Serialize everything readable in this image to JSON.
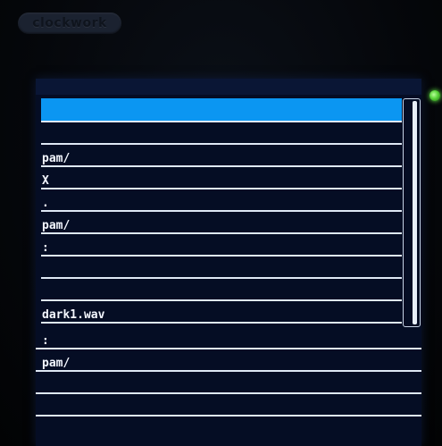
{
  "device": {
    "brand": "clockwork",
    "led_color": "#6cff4a"
  },
  "screen": {
    "highlight_color": "#0b96f2",
    "rows": [
      {
        "label": ""
      },
      {
        "label": ""
      },
      {
        "label": "pam/"
      },
      {
        "label": "X"
      },
      {
        "label": "."
      },
      {
        "label": "pam/"
      },
      {
        "label": ":"
      },
      {
        "label": ""
      },
      {
        "label": ""
      },
      {
        "label": "dark1.wav"
      }
    ],
    "lower_rows": [
      {
        "label": ":"
      },
      {
        "label": "pam/"
      },
      {
        "label": ""
      },
      {
        "label": ""
      }
    ],
    "scroll_position": 0.0
  }
}
